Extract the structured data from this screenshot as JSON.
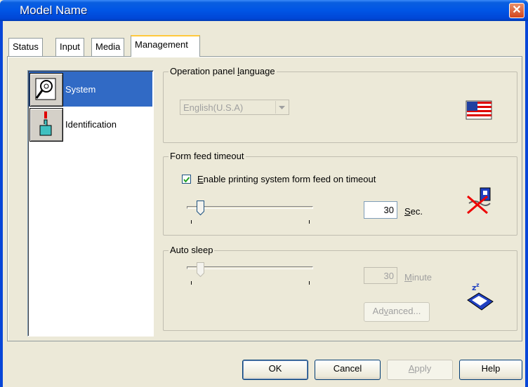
{
  "window": {
    "title": "Model Name",
    "close_glyph": "✕"
  },
  "tabs": [
    {
      "label": "Status"
    },
    {
      "label": "Input"
    },
    {
      "label": "Media"
    },
    {
      "label": "Management",
      "selected": true
    }
  ],
  "sidebar": {
    "items": [
      {
        "label": "System",
        "icon": "system-search-icon",
        "selected": true
      },
      {
        "label": "Identification",
        "icon": "identification-hand-icon",
        "selected": false
      }
    ]
  },
  "operation_panel": {
    "title_pre": "Operation panel ",
    "title_accel": "l",
    "title_post": "anguage",
    "language_value": "English(U.S.A)",
    "flag_icon": "us-flag-icon"
  },
  "form_feed": {
    "title": "Form feed timeout",
    "checkbox_accel": "E",
    "checkbox_label_rest": "nable printing system form feed on timeout",
    "checkbox_checked": true,
    "value": "30",
    "unit_accel": "S",
    "unit_rest": "ec.",
    "icon": "form-feed-disabled-icon"
  },
  "auto_sleep": {
    "title": "Auto sleep",
    "value": "30",
    "unit_accel": "M",
    "unit_rest": "inute",
    "advanced_pre": "Ad",
    "advanced_accel": "v",
    "advanced_post": "anced...",
    "icon": "sleep-printer-icon"
  },
  "footer": {
    "ok": "OK",
    "cancel": "Cancel",
    "apply_accel": "A",
    "apply_rest": "pply",
    "help": "Help"
  },
  "colors": {
    "accent": "#316ac5",
    "title_bar": "#0055e5",
    "face": "#ece9d8"
  }
}
